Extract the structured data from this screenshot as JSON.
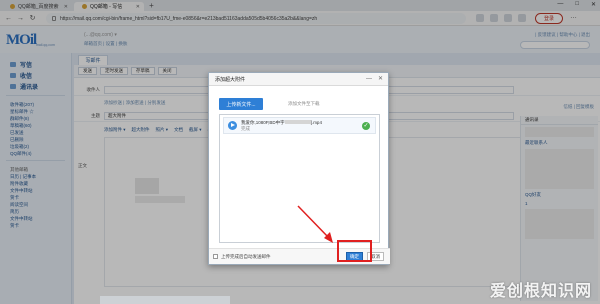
{
  "browser": {
    "tabs": [
      {
        "label": "QQ邮箱_百度搜索"
      },
      {
        "label": "QQ邮箱 - 写信"
      }
    ],
    "new_tab": "+",
    "window_controls": [
      "—",
      "□",
      "✕"
    ],
    "url": "https://mail.qq.com/cgi-bin/frame_html?sid=fb17U_fme-e0856&r=e213bad51163adda505d5b4056c35a2b&&lang=zh",
    "login_button": "登录",
    "menu": "…"
  },
  "mail": {
    "logo": "MOil",
    "logo_sub": "mail.qq.com",
    "account_text": "(...@qq.com) ▾",
    "account_links": "邮箱首页 | 设置 | 换肤",
    "top_links": "| 反馈建议 | 帮助中心 | 退出",
    "sidebar_main": [
      {
        "label": "写信"
      },
      {
        "label": "收信"
      },
      {
        "label": "通讯录"
      }
    ],
    "sidebar_list": [
      {
        "label": "收件箱(207)"
      },
      {
        "label": "星标邮件 ☆"
      },
      {
        "label": "群邮件(8)"
      },
      {
        "label": "草稿箱(60)"
      },
      {
        "label": "已发送"
      },
      {
        "label": "已删除"
      },
      {
        "label": "垃圾箱(2)"
      },
      {
        "label": "QQ邮件(4)"
      }
    ],
    "sidebar_list2": [
      {
        "label": "其他邮箱"
      },
      {
        "label": "日历 | 记事本"
      },
      {
        "label": "附件收藏"
      },
      {
        "label": "文件中转站"
      },
      {
        "label": "贺卡"
      },
      {
        "label": "阅读空间"
      },
      {
        "label": "简历"
      },
      {
        "label": "文件中转站"
      },
      {
        "label": "贺卡"
      }
    ],
    "content_tab": "写邮件",
    "actions": [
      "发送",
      "定时发送",
      "存草稿",
      "关闭"
    ],
    "field_recipient": "收件人",
    "field_subject": "主题",
    "subject_value": "超大附件",
    "recipient_links": "添加抄送 | 添加密送 | 分别发送",
    "format_bar": [
      "添加附件 ▾",
      "超大附件",
      "照片 ▾",
      "文档",
      "截屏 ▾",
      "表情",
      "更多 ▾"
    ],
    "field_body": "正文",
    "right_panel": {
      "title": "通讯录",
      "link": "全部 | 多选",
      "item1": "最近联系人",
      "item2": "QQ好友",
      "item3": "1"
    },
    "right_links": "信纸 | 回复模板"
  },
  "dialog": {
    "title": "添加超大附件",
    "controls": [
      "—",
      "✕"
    ],
    "upload_button": "上传新文件...",
    "upload_hint": "添加文件至下载",
    "file_name_prefix": "我爱你,1080P,BD中字",
    "file_name_suffix": "].mp4",
    "file_status": "完成",
    "checkbox_label": "上传完成后自动发送邮件",
    "ok_button": "确定",
    "cancel_button": "取消"
  },
  "watermark": "爱创根知识网",
  "colors": {
    "accent": "#2e7fd6",
    "highlight": "#e02020",
    "success": "#4caf50"
  }
}
